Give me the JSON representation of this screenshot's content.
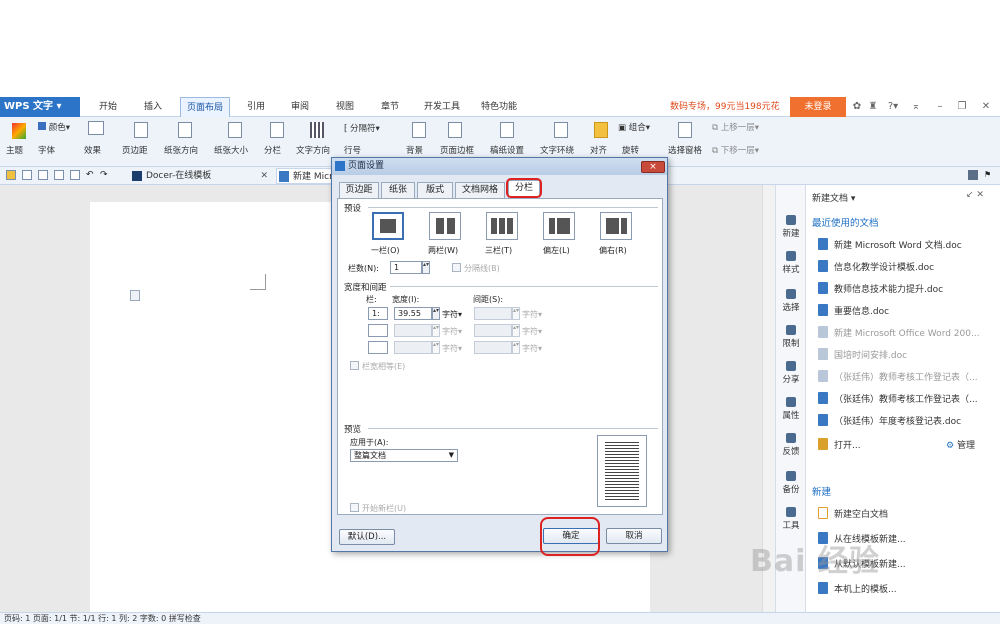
{
  "app": {
    "name": "WPS 文字"
  },
  "menu_tabs": [
    "开始",
    "插入",
    "页面布局",
    "引用",
    "审阅",
    "视图",
    "章节",
    "开发工具",
    "特色功能"
  ],
  "active_menu_tab": "页面布局",
  "promo": "数码专场，99元当198元花",
  "login_label": "未登录",
  "ribbon": {
    "row1": [
      "颜色",
      "分隔符",
      "组合",
      "上移一层"
    ],
    "row2": [
      "主题",
      "字体",
      "效果",
      "页边距",
      "纸张方向",
      "纸张大小",
      "分栏",
      "文字方向",
      "行号",
      "背景",
      "页面边框",
      "稿纸设置",
      "文字环绕",
      "对齐",
      "旋转",
      "选择窗格",
      "下移一层"
    ]
  },
  "doc_tabs": [
    "Docer-在线模板",
    "新建 Microsoft Word 文档"
  ],
  "side_tabs": [
    "新建",
    "样式",
    "选择",
    "限制",
    "分享",
    "属性",
    "反馈",
    "备份",
    "工具"
  ],
  "panel": {
    "dropdown": "新建文档",
    "recent_header": "最近使用的文档",
    "recent": [
      {
        "name": "新建 Microsoft Word 文档.doc",
        "gray": false
      },
      {
        "name": "信息化教学设计模板.doc",
        "gray": false
      },
      {
        "name": "教师信息技术能力提升.doc",
        "gray": false
      },
      {
        "name": "重要信息.doc",
        "gray": false
      },
      {
        "name": "新建 Microsoft Office Word 200...",
        "gray": true
      },
      {
        "name": "国培时间安排.doc",
        "gray": true
      },
      {
        "name": "（张廷伟）教师考核工作登记表（...",
        "gray": true
      },
      {
        "name": "（张廷伟）教师考核工作登记表（...",
        "gray": false
      },
      {
        "name": "（张廷伟）年度考核登记表.doc",
        "gray": false
      }
    ],
    "open": "打开...",
    "manage": "管理",
    "new_header": "新建",
    "new_items": [
      "新建空白文档",
      "从在线模板新建...",
      "从默认模板新建...",
      "本机上的模板..."
    ]
  },
  "status": "页码: 1  页面: 1/1  节: 1/1  行: 1  列: 2  字数: 0  拼写检查",
  "dialog": {
    "title": "页面设置",
    "close": "×",
    "tabs": [
      "页边距",
      "纸张",
      "版式",
      "文档网格",
      "分栏"
    ],
    "active_tab": "分栏",
    "preset_label": "预设",
    "presets": [
      "一栏(O)",
      "两栏(W)",
      "三栏(T)",
      "偏左(L)",
      "偏右(R)"
    ],
    "num_cols_label": "栏数(N):",
    "num_cols": "1",
    "separator_label": "分隔线(B)",
    "width_spacing_label": "宽度和间距",
    "col_label": "栏:",
    "width_label": "宽度(I):",
    "spacing_label": "间距(S):",
    "col1": "1:",
    "width1": "39.55",
    "unit": "字符▾",
    "equal_width_label": "栏宽相等(E)",
    "preview_label": "预览",
    "apply_to_label": "应用于(A):",
    "apply_to": "整篇文档",
    "new_col_label": "开始新栏(U)",
    "default_btn": "默认(D)...",
    "ok_btn": "确定",
    "cancel_btn": "取消"
  },
  "watermark": "Bai 经验"
}
